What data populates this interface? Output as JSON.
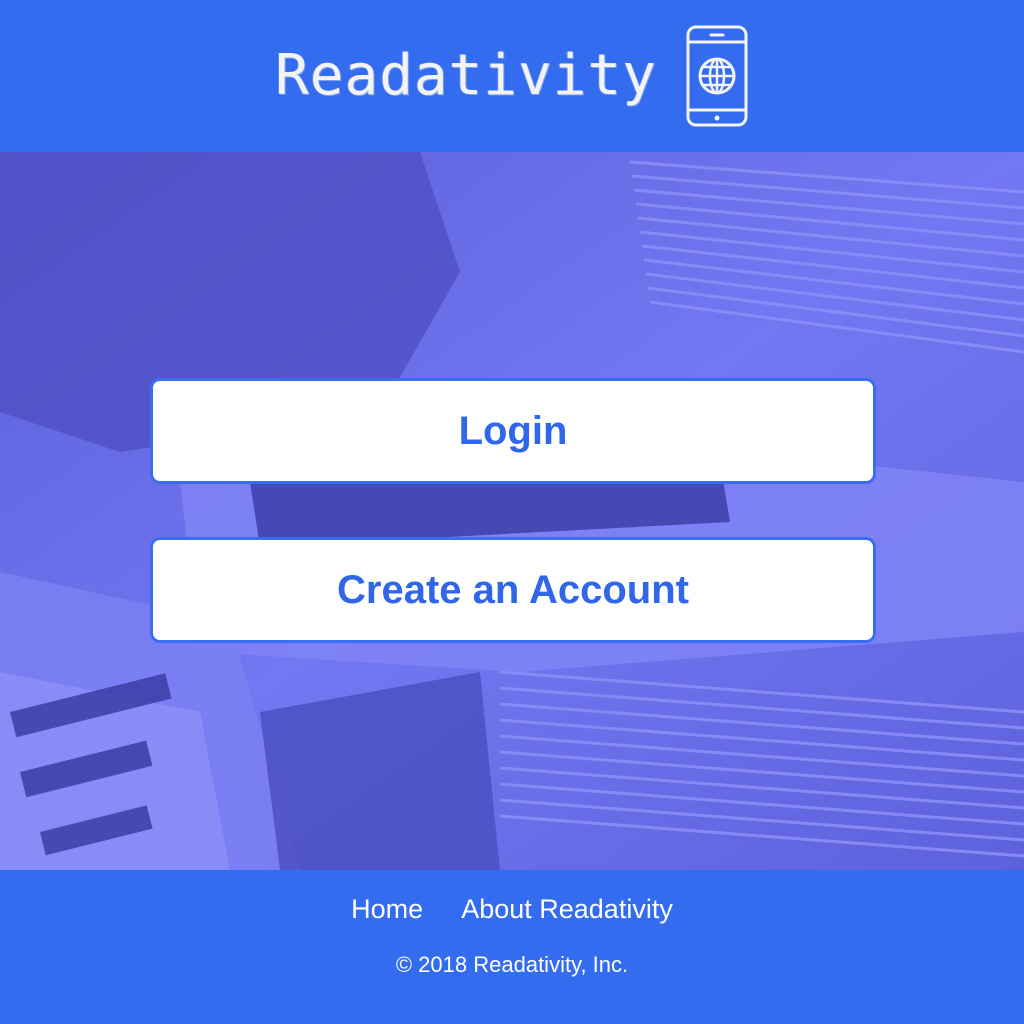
{
  "header": {
    "title": "Readativity",
    "logo_icon": "mobile-phone-globe-icon"
  },
  "hero": {
    "background_description_color": "#6a6ff0",
    "login_label": "Login",
    "create_account_label": "Create an Account"
  },
  "footer": {
    "links": [
      {
        "label": "Home"
      },
      {
        "label": "About Readativity"
      }
    ],
    "copyright": "© 2018 Readativity, Inc."
  },
  "colors": {
    "brand_blue": "#346cf0",
    "button_text": "#3066e8",
    "button_bg": "#ffffff",
    "overlay": "#6a6ff0"
  }
}
